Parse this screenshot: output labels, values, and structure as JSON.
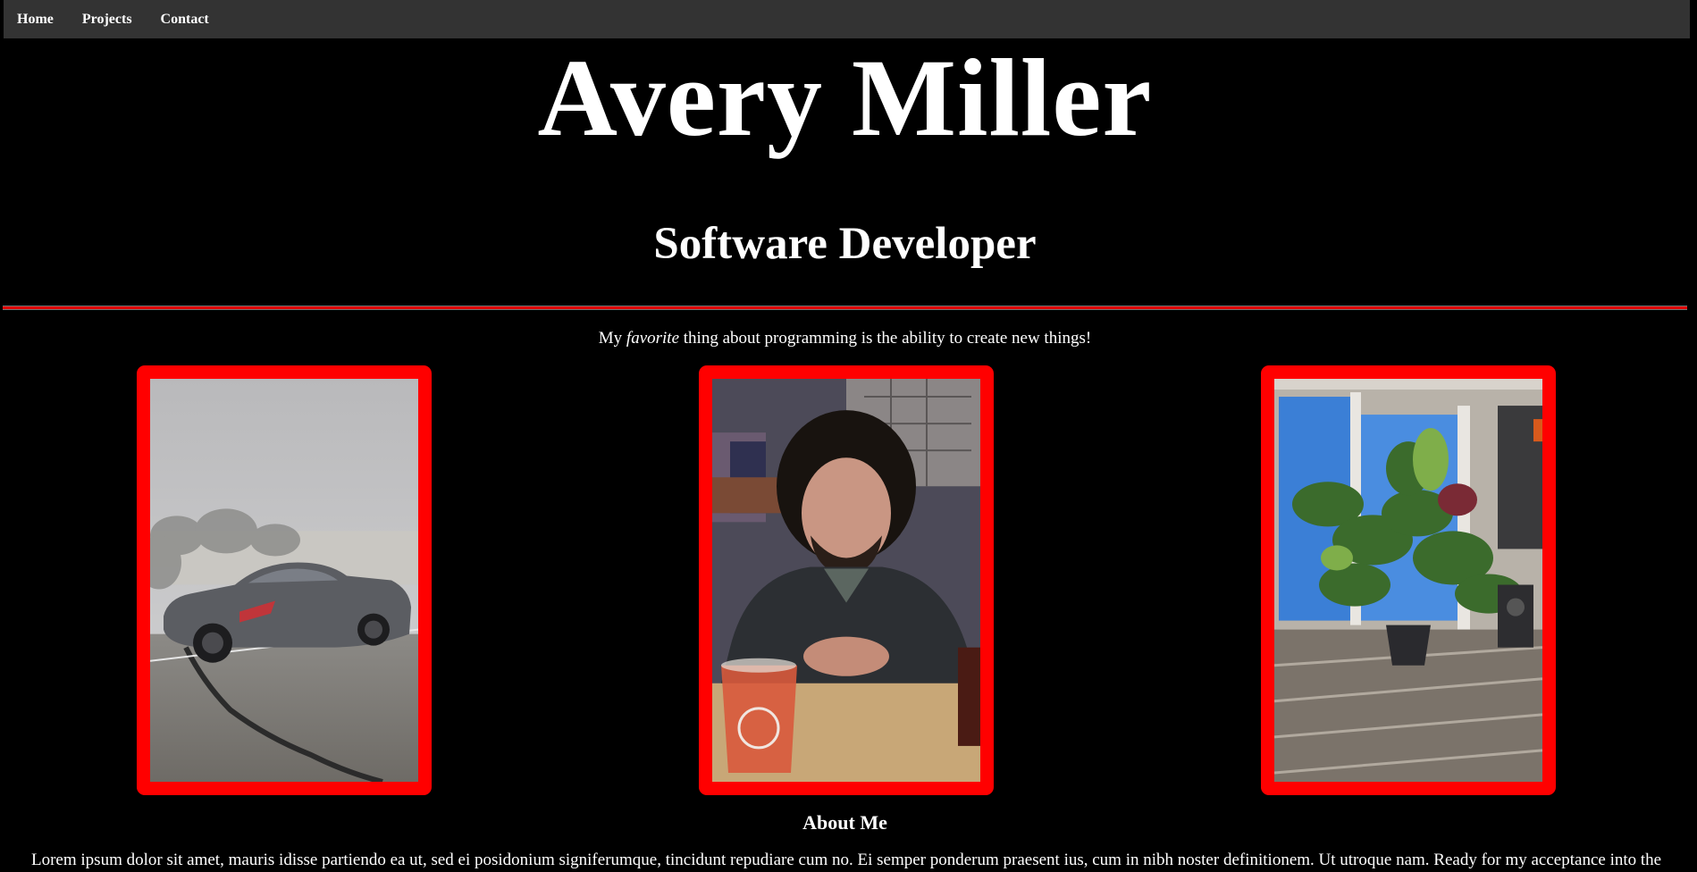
{
  "nav": {
    "items": [
      {
        "label": "Home"
      },
      {
        "label": "Projects"
      },
      {
        "label": "Contact"
      }
    ]
  },
  "header": {
    "title": "Avery Miller",
    "subtitle": "Software Developer"
  },
  "tagline": {
    "before": "My ",
    "emphasis": "favorite",
    "after": " thing about programming is the ability to create new things!"
  },
  "gallery": {
    "frame_color": "#ff0000",
    "photos": [
      {
        "subject": "gray sports car on frosty road"
      },
      {
        "subject": "portrait of man with curly hair at table"
      },
      {
        "subject": "monstera plants by sunny window"
      }
    ]
  },
  "about": {
    "heading": "About Me",
    "text": "Lorem ipsum dolor sit amet, mauris idisse partiendo ea ut, sed ei posidonium signiferumque, tincidunt repudiare cum no. Ei semper ponderum praesent ius, cum in nibh noster definitionem. Ut utroque nam. Ready for my acceptance into the"
  },
  "colors": {
    "background": "#000000",
    "navbar": "#333333",
    "accent": "#ff0000",
    "text": "#ffffff"
  }
}
